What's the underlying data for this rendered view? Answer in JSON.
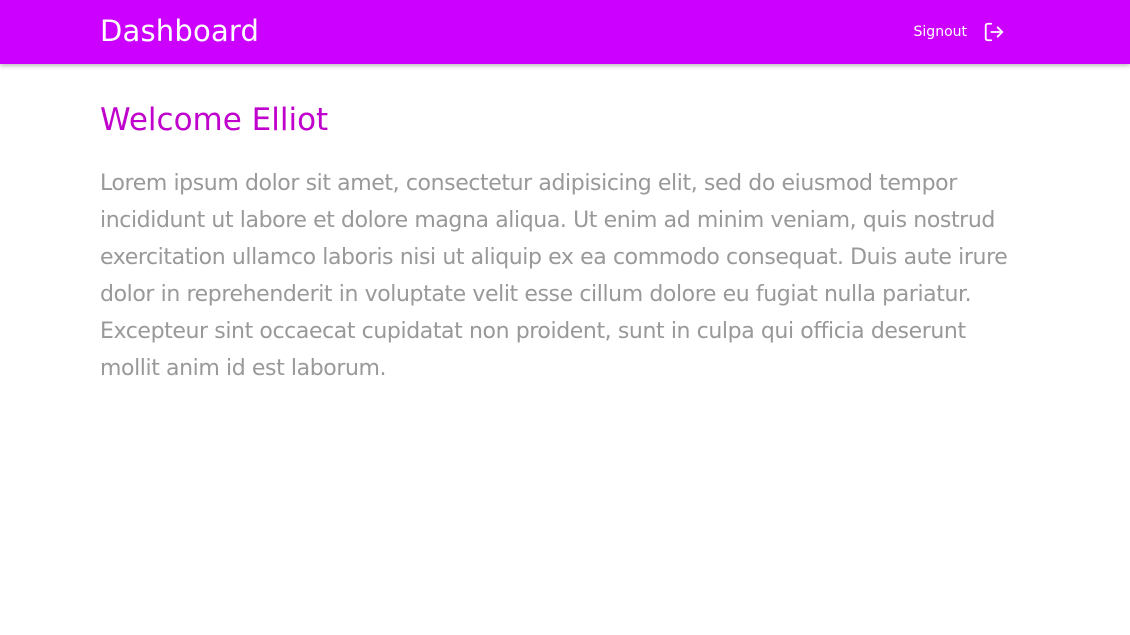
{
  "header": {
    "title": "Dashboard",
    "signout_label": "Signout",
    "signout_icon": "logout-icon"
  },
  "main": {
    "welcome": "Welcome Elliot",
    "body": "Lorem ipsum dolor sit amet, consectetur adipisicing elit, sed do eiusmod tempor incididunt ut labore et dolore magna aliqua. Ut enim ad minim veniam, quis nostrud exercitation ullamco laboris nisi ut aliquip ex ea commodo consequat. Duis aute irure dolor in reprehenderit in voluptate velit esse cillum dolore eu fugiat nulla pariatur. Excepteur sint occaecat cupidatat non proident, sunt in culpa qui officia deserunt mollit anim id est laborum."
  },
  "colors": {
    "header_bg": "#cc00ff",
    "heading": "#c000cc",
    "body_text": "#999999"
  }
}
